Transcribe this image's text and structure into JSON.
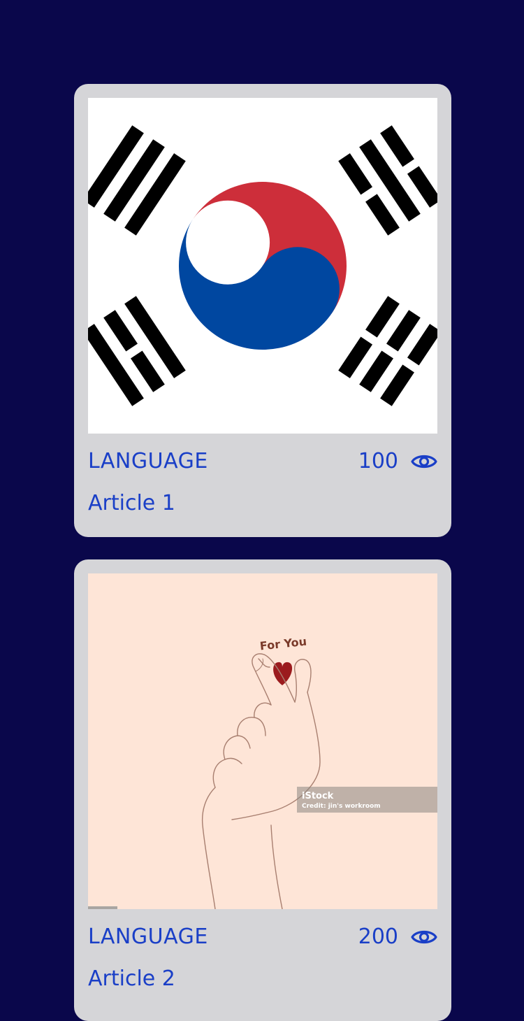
{
  "articles": [
    {
      "image": "south-korea-flag",
      "category": "LANGUAGE",
      "views": "100",
      "title": "Article 1"
    },
    {
      "image": "finger-heart-illustration",
      "image_caption": "For You",
      "watermark_brand": "iStock",
      "watermark_credit": "Credit: jin's workroom",
      "category": "LANGUAGE",
      "views": "200",
      "title": "Article 2"
    }
  ],
  "colors": {
    "background": "#0a074b",
    "card": "#d5d5d8",
    "text": "#1a3fc7",
    "flag_red": "#cd2e3a",
    "flag_blue": "#0047a0",
    "illustration_bg": "#fee5d7",
    "heart": "#9b1b1e"
  },
  "icons": {
    "views": "eye-icon"
  }
}
